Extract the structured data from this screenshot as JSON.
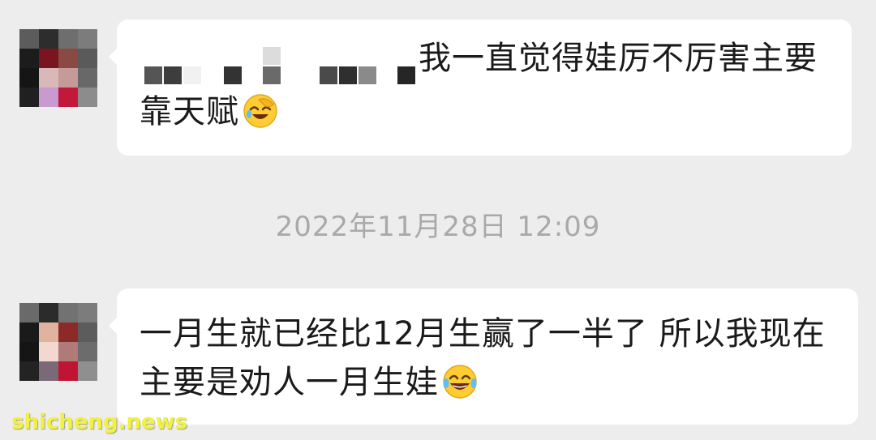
{
  "messages": [
    {
      "sender": "contact",
      "line1": "我一直觉得娃厉不厉害主要",
      "line2": "靠天赋",
      "emoji": "face-palm-laughing-emoji"
    },
    {
      "sender": "contact",
      "line1": "一月生就已经比12月生赢了一半了 所以我现在",
      "line2": "主要是劝人一月生娃",
      "emoji": "tears-of-joy-emoji"
    }
  ],
  "timestamp": "2022年11月28日 12:09",
  "watermark": "shicheng.news",
  "colors": {
    "background": "#ededed",
    "bubble": "#ffffff",
    "text": "#1a1a1a",
    "timestamp": "#a9a9a9",
    "watermark": "#f2f23a"
  }
}
